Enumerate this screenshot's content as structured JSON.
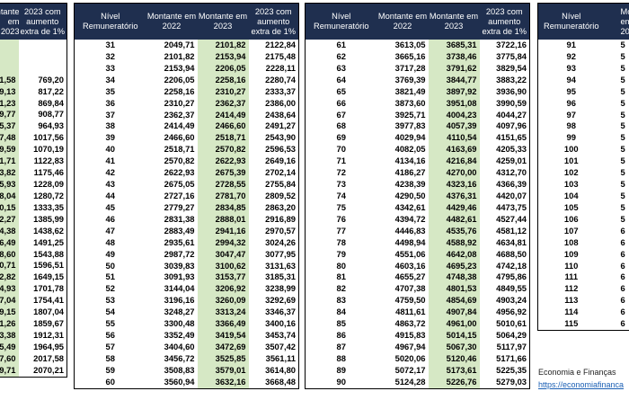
{
  "headers": {
    "level": "Nível Remuneratório",
    "amount_2022": "Montante em 2022",
    "amount_2023": "Montante em 2023",
    "amount_2023_extra": "2023 com aumento extra de 1%",
    "amount_2023_cut": "Montante em 2023",
    "extra_cut": "2023 com aumento extra de 1%"
  },
  "table1_rows": [
    {
      "v2023": "",
      "v2023x": ""
    },
    {
      "v2023": "",
      "v2023x": ""
    },
    {
      "v2023": "",
      "v2023x": ""
    },
    {
      "v2023": "1,58",
      "v2023x": "769,20"
    },
    {
      "v2023": "9,13",
      "v2023x": "817,22"
    },
    {
      "v2023": "1,23",
      "v2023x": "869,84"
    },
    {
      "v2023": "9,77",
      "v2023x": "908,77"
    },
    {
      "v2023": "5,37",
      "v2023x": "964,93"
    },
    {
      "v2023": "7,48",
      "v2023x": "1017,56"
    },
    {
      "v2023": "9,59",
      "v2023x": "1070,19"
    },
    {
      "v2023": "1,71",
      "v2023x": "1122,83"
    },
    {
      "v2023": "3,82",
      "v2023x": "1175,46"
    },
    {
      "v2023": "5,93",
      "v2023x": "1228,09"
    },
    {
      "v2023": "8,04",
      "v2023x": "1280,72"
    },
    {
      "v2023": "0,15",
      "v2023x": "1333,35"
    },
    {
      "v2023": "2,27",
      "v2023x": "1385,99"
    },
    {
      "v2023": "4,38",
      "v2023x": "1438,62"
    },
    {
      "v2023": "6,49",
      "v2023x": "1491,25"
    },
    {
      "v2023": "8,60",
      "v2023x": "1543,88"
    },
    {
      "v2023": "0,71",
      "v2023x": "1596,51"
    },
    {
      "v2023": "2,82",
      "v2023x": "1649,15"
    },
    {
      "v2023": "4,93",
      "v2023x": "1701,78"
    },
    {
      "v2023": "7,04",
      "v2023x": "1754,41"
    },
    {
      "v2023": "9,15",
      "v2023x": "1807,04"
    },
    {
      "v2023": "1,26",
      "v2023x": "1859,67"
    },
    {
      "v2023": "3,38",
      "v2023x": "1912,31"
    },
    {
      "v2023": "5,49",
      "v2023x": "1964,95"
    },
    {
      "v2023": "7,60",
      "v2023x": "2017,58"
    },
    {
      "v2023": "9,71",
      "v2023x": "2070,21"
    }
  ],
  "table2_rows": [
    {
      "level": "31",
      "v2022": "2049,71",
      "v2023": "2101,82",
      "v2023x": "2122,84"
    },
    {
      "level": "32",
      "v2022": "2101,82",
      "v2023": "2153,94",
      "v2023x": "2175,48"
    },
    {
      "level": "33",
      "v2022": "2153,94",
      "v2023": "2206,05",
      "v2023x": "2228,11"
    },
    {
      "level": "34",
      "v2022": "2206,05",
      "v2023": "2258,16",
      "v2023x": "2280,74"
    },
    {
      "level": "35",
      "v2022": "2258,16",
      "v2023": "2310,27",
      "v2023x": "2333,37"
    },
    {
      "level": "36",
      "v2022": "2310,27",
      "v2023": "2362,37",
      "v2023x": "2386,00"
    },
    {
      "level": "37",
      "v2022": "2362,37",
      "v2023": "2414,49",
      "v2023x": "2438,64"
    },
    {
      "level": "38",
      "v2022": "2414,49",
      "v2023": "2466,60",
      "v2023x": "2491,27"
    },
    {
      "level": "39",
      "v2022": "2466,60",
      "v2023": "2518,71",
      "v2023x": "2543,90"
    },
    {
      "level": "40",
      "v2022": "2518,71",
      "v2023": "2570,82",
      "v2023x": "2596,53"
    },
    {
      "level": "41",
      "v2022": "2570,82",
      "v2023": "2622,93",
      "v2023x": "2649,16"
    },
    {
      "level": "42",
      "v2022": "2622,93",
      "v2023": "2675,39",
      "v2023x": "2702,14"
    },
    {
      "level": "43",
      "v2022": "2675,05",
      "v2023": "2728,55",
      "v2023x": "2755,84"
    },
    {
      "level": "44",
      "v2022": "2727,16",
      "v2023": "2781,70",
      "v2023x": "2809,52"
    },
    {
      "level": "45",
      "v2022": "2779,27",
      "v2023": "2834,85",
      "v2023x": "2863,20"
    },
    {
      "level": "46",
      "v2022": "2831,38",
      "v2023": "2888,01",
      "v2023x": "2916,89"
    },
    {
      "level": "47",
      "v2022": "2883,49",
      "v2023": "2941,16",
      "v2023x": "2970,57"
    },
    {
      "level": "48",
      "v2022": "2935,61",
      "v2023": "2994,32",
      "v2023x": "3024,26"
    },
    {
      "level": "49",
      "v2022": "2987,72",
      "v2023": "3047,47",
      "v2023x": "3077,95"
    },
    {
      "level": "50",
      "v2022": "3039,83",
      "v2023": "3100,62",
      "v2023x": "3131,63"
    },
    {
      "level": "51",
      "v2022": "3091,93",
      "v2023": "3153,77",
      "v2023x": "3185,31"
    },
    {
      "level": "52",
      "v2022": "3144,04",
      "v2023": "3206,92",
      "v2023x": "3238,99"
    },
    {
      "level": "53",
      "v2022": "3196,16",
      "v2023": "3260,09",
      "v2023x": "3292,69"
    },
    {
      "level": "54",
      "v2022": "3248,27",
      "v2023": "3313,24",
      "v2023x": "3346,37"
    },
    {
      "level": "55",
      "v2022": "3300,48",
      "v2023": "3366,49",
      "v2023x": "3400,16"
    },
    {
      "level": "56",
      "v2022": "3352,49",
      "v2023": "3419,54",
      "v2023x": "3453,74"
    },
    {
      "level": "57",
      "v2022": "3404,60",
      "v2023": "3472,69",
      "v2023x": "3507,42"
    },
    {
      "level": "58",
      "v2022": "3456,72",
      "v2023": "3525,85",
      "v2023x": "3561,11"
    },
    {
      "level": "59",
      "v2022": "3508,83",
      "v2023": "3579,01",
      "v2023x": "3614,80"
    },
    {
      "level": "60",
      "v2022": "3560,94",
      "v2023": "3632,16",
      "v2023x": "3668,48"
    }
  ],
  "table3_rows": [
    {
      "level": "61",
      "v2022": "3613,05",
      "v2023": "3685,31",
      "v2023x": "3722,16"
    },
    {
      "level": "62",
      "v2022": "3665,16",
      "v2023": "3738,46",
      "v2023x": "3775,84"
    },
    {
      "level": "63",
      "v2022": "3717,28",
      "v2023": "3791,62",
      "v2023x": "3829,54"
    },
    {
      "level": "64",
      "v2022": "3769,39",
      "v2023": "3844,77",
      "v2023x": "3883,22"
    },
    {
      "level": "65",
      "v2022": "3821,49",
      "v2023": "3897,92",
      "v2023x": "3936,90"
    },
    {
      "level": "66",
      "v2022": "3873,60",
      "v2023": "3951,08",
      "v2023x": "3990,59"
    },
    {
      "level": "67",
      "v2022": "3925,71",
      "v2023": "4004,23",
      "v2023x": "4044,27"
    },
    {
      "level": "68",
      "v2022": "3977,83",
      "v2023": "4057,39",
      "v2023x": "4097,96"
    },
    {
      "level": "69",
      "v2022": "4029,94",
      "v2023": "4110,54",
      "v2023x": "4151,65"
    },
    {
      "level": "70",
      "v2022": "4082,05",
      "v2023": "4163,69",
      "v2023x": "4205,33"
    },
    {
      "level": "71",
      "v2022": "4134,16",
      "v2023": "4216,84",
      "v2023x": "4259,01"
    },
    {
      "level": "72",
      "v2022": "4186,27",
      "v2023": "4270,00",
      "v2023x": "4312,70"
    },
    {
      "level": "73",
      "v2022": "4238,39",
      "v2023": "4323,16",
      "v2023x": "4366,39"
    },
    {
      "level": "74",
      "v2022": "4290,50",
      "v2023": "4376,31",
      "v2023x": "4420,07"
    },
    {
      "level": "75",
      "v2022": "4342,61",
      "v2023": "4429,46",
      "v2023x": "4473,75"
    },
    {
      "level": "76",
      "v2022": "4394,72",
      "v2023": "4482,61",
      "v2023x": "4527,44"
    },
    {
      "level": "77",
      "v2022": "4446,83",
      "v2023": "4535,76",
      "v2023x": "4581,12"
    },
    {
      "level": "78",
      "v2022": "4498,94",
      "v2023": "4588,92",
      "v2023x": "4634,81"
    },
    {
      "level": "79",
      "v2022": "4551,06",
      "v2023": "4642,08",
      "v2023x": "4688,50"
    },
    {
      "level": "80",
      "v2022": "4603,16",
      "v2023": "4695,23",
      "v2023x": "4742,18"
    },
    {
      "level": "81",
      "v2022": "4655,27",
      "v2023": "4748,38",
      "v2023x": "4795,86"
    },
    {
      "level": "82",
      "v2022": "4707,38",
      "v2023": "4801,53",
      "v2023x": "4849,55"
    },
    {
      "level": "83",
      "v2022": "4759,50",
      "v2023": "4854,69",
      "v2023x": "4903,24"
    },
    {
      "level": "84",
      "v2022": "4811,61",
      "v2023": "4907,84",
      "v2023x": "4956,92"
    },
    {
      "level": "85",
      "v2022": "4863,72",
      "v2023": "4961,00",
      "v2023x": "5010,61"
    },
    {
      "level": "86",
      "v2022": "4915,83",
      "v2023": "5014,15",
      "v2023x": "5064,29"
    },
    {
      "level": "87",
      "v2022": "4967,94",
      "v2023": "5067,30",
      "v2023x": "5117,97"
    },
    {
      "level": "88",
      "v2022": "5020,06",
      "v2023": "5120,46",
      "v2023x": "5171,66"
    },
    {
      "level": "89",
      "v2022": "5072,17",
      "v2023": "5173,61",
      "v2023x": "5225,35"
    },
    {
      "level": "90",
      "v2022": "5124,28",
      "v2023": "5226,76",
      "v2023x": "5279,03"
    }
  ],
  "table4_rows": [
    {
      "level": "91",
      "v2022": "5"
    },
    {
      "level": "92",
      "v2022": "5"
    },
    {
      "level": "93",
      "v2022": "5"
    },
    {
      "level": "94",
      "v2022": "5"
    },
    {
      "level": "95",
      "v2022": "5"
    },
    {
      "level": "96",
      "v2022": "5"
    },
    {
      "level": "97",
      "v2022": "5"
    },
    {
      "level": "98",
      "v2022": "5"
    },
    {
      "level": "99",
      "v2022": "5"
    },
    {
      "level": "100",
      "v2022": "5"
    },
    {
      "level": "101",
      "v2022": "5"
    },
    {
      "level": "102",
      "v2022": "5"
    },
    {
      "level": "103",
      "v2022": "5"
    },
    {
      "level": "104",
      "v2022": "5"
    },
    {
      "level": "105",
      "v2022": "5"
    },
    {
      "level": "106",
      "v2022": "5"
    },
    {
      "level": "107",
      "v2022": "6"
    },
    {
      "level": "108",
      "v2022": "6"
    },
    {
      "level": "109",
      "v2022": "6"
    },
    {
      "level": "110",
      "v2022": "6"
    },
    {
      "level": "111",
      "v2022": "6"
    },
    {
      "level": "112",
      "v2022": "6"
    },
    {
      "level": "113",
      "v2022": "6"
    },
    {
      "level": "114",
      "v2022": "6"
    },
    {
      "level": "115",
      "v2022": "6"
    }
  ],
  "footer": {
    "title": "Economia e Finanças",
    "link": "https://economiafinanca"
  }
}
